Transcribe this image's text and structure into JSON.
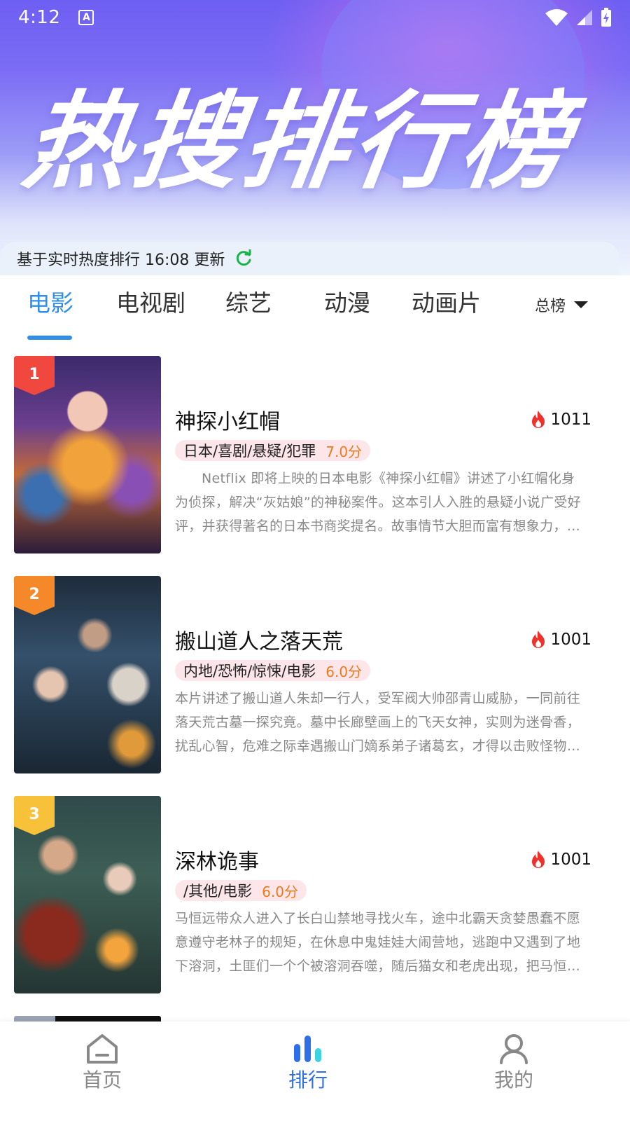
{
  "status_bar": {
    "time": "4:12",
    "indicator": "A"
  },
  "banner": {
    "title": "热搜排行榜"
  },
  "update": {
    "text": "基于实时热度排行 16:08 更新"
  },
  "tabs": [
    {
      "label": "电影",
      "active": true
    },
    {
      "label": "电视剧",
      "active": false
    },
    {
      "label": "综艺",
      "active": false
    },
    {
      "label": "动漫",
      "active": false
    },
    {
      "label": "动画片",
      "active": false
    }
  ],
  "rank_filter": {
    "selected": "总榜"
  },
  "items": [
    {
      "rank": "1",
      "title": "神探小红帽",
      "heat": "1011",
      "tags": "日本/喜剧/悬疑/犯罪",
      "score": "7.0分",
      "desc": "Netflix 即将上映的日本电影《神探小红帽》讲述了小红帽化身为侦探，解决“灰姑娘”的神秘案件。这本引人入胜的悬疑小说广受好评，并获得著名的日本书商奖提名。故事情节大胆而富有想象力，虽然改编成电影难度较大，但相信一定会是一部有趣的作品。",
      "badge_color": "#f0483e"
    },
    {
      "rank": "2",
      "title": "搬山道人之落天荒",
      "heat": "1001",
      "tags": "内地/恐怖/惊悚/电影",
      "score": "6.0分",
      "desc": "本片讲述了搬山道人朱却一行人，受军阀大帅邵青山威胁，一同前往落天荒古墓一探究竟。墓中长廊壁画上的飞天女神，实则为迷骨香，扰乱心智，危难之际幸遇搬山门嫡系弟子诸葛玄，才得以击败怪物，逃出生天。",
      "badge_color": "#f5892a"
    },
    {
      "rank": "3",
      "title": "深林诡事",
      "heat": "1001",
      "tags": "/其他/电影",
      "score": "6.0分",
      "desc": "马恒远带众人进入了长白山禁地寻找火车，途中北霸天贪婪愚蠢不愿意遵守老林子的规矩，在休息中鬼娃娃大闹营地，逃跑中又遇到了地下溶洞，土匪们一个个被溶洞吞噬，随后猫女和老虎出现，把马恒远一行人逼入绝境。",
      "badge_color": "#f7c23a"
    }
  ],
  "bottom_nav": [
    {
      "label": "首页",
      "icon": "home-icon",
      "active": false
    },
    {
      "label": "排行",
      "icon": "ranking-icon",
      "active": true
    },
    {
      "label": "我的",
      "icon": "profile-icon",
      "active": false
    }
  ],
  "colors": {
    "accent": "#2e8ee8",
    "score": "#f07a1a",
    "tag_bg": "#fde6ea",
    "refresh": "#19b34a"
  }
}
